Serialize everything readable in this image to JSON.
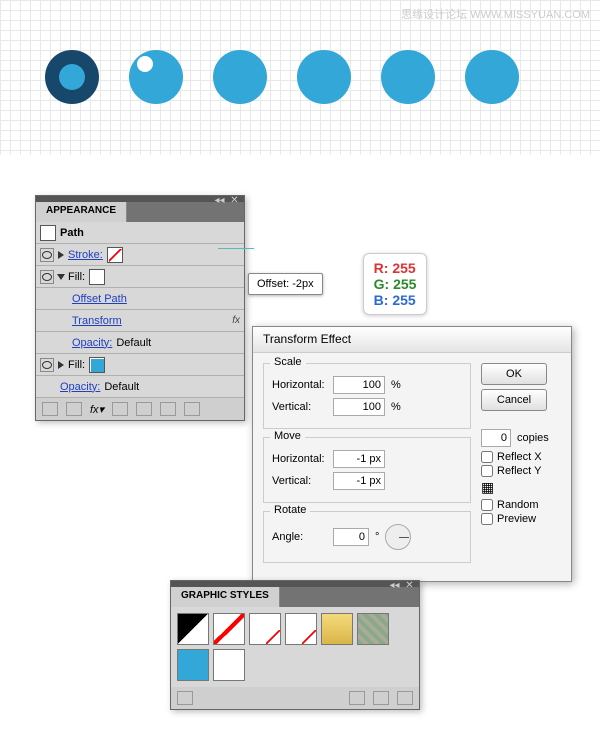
{
  "watermark": "思缘设计论坛  WWW.MISSYUAN.COM",
  "appearance": {
    "title": "APPEARANCE",
    "path_label": "Path",
    "stroke_label": "Stroke:",
    "fill_label": "Fill:",
    "offset_path": "Offset Path",
    "transform": "Transform",
    "opacity_label": "Opacity:",
    "opacity_value": "Default",
    "fx": "fx"
  },
  "offset_callout": "Offset: -2px",
  "rgb": {
    "r": "R: 255",
    "g": "G: 255",
    "b": "B: 255"
  },
  "transform_dialog": {
    "title": "Transform Effect",
    "scale": "Scale",
    "move": "Move",
    "rotate": "Rotate",
    "horizontal": "Horizontal:",
    "vertical": "Vertical:",
    "angle": "Angle:",
    "scale_h": "100",
    "scale_v": "100",
    "move_h": "-1 px",
    "move_v": "-1 px",
    "angle_val": "0",
    "percent": "%",
    "copies_val": "0",
    "copies": "copies",
    "ok": "OK",
    "cancel": "Cancel",
    "reflect_x": "Reflect X",
    "reflect_y": "Reflect Y",
    "random": "Random",
    "preview": "Preview",
    "dropdown": "°"
  },
  "graphic_styles": {
    "title": "GRAPHIC STYLES"
  }
}
